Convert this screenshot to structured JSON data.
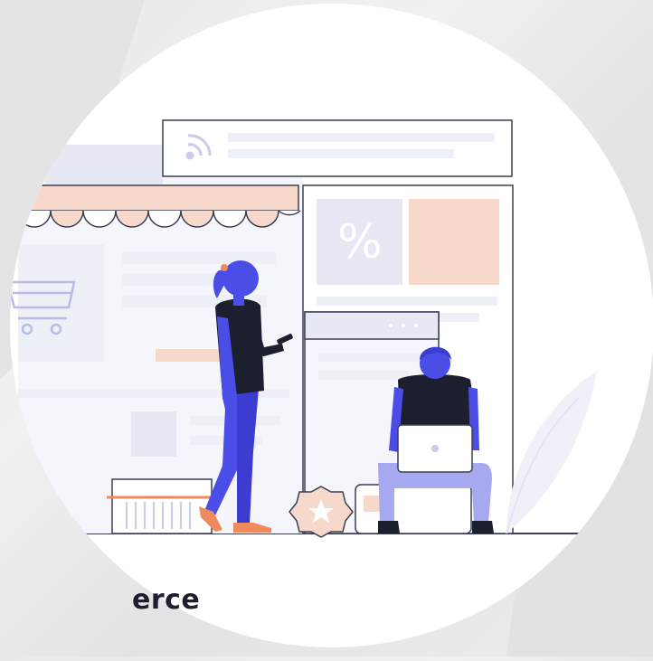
{
  "caption": "erce",
  "colors": {
    "background": "#ececed",
    "circle": "#ffffff",
    "accent_peach": "#f7d9cc",
    "accent_orange": "#f08a5d",
    "figure_blue": "#4b4ee6",
    "figure_light_blue": "#a6a9f0",
    "dark_navy": "#1b1f2e",
    "panel_gray": "#e6e8f3"
  },
  "icons": [
    "rss-icon",
    "shopping-cart-icon",
    "percent-icon",
    "star-badge-icon",
    "smartphone-icon",
    "laptop-icon"
  ],
  "percent_symbol": "%"
}
